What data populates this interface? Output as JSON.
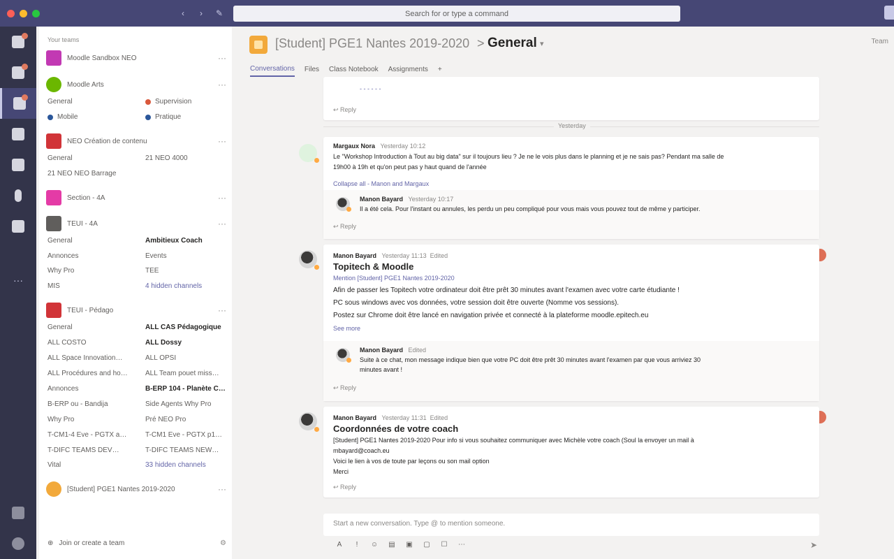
{
  "search": {
    "placeholder": "Search for or type a command"
  },
  "sidebar_header": "Your teams",
  "teams": [
    {
      "name": "Moodle Sandbox NEO",
      "color": "#c239b3"
    },
    {
      "name": "Moodle Arts",
      "color": "#6bb700"
    },
    {
      "name": "NEO Création de contenu",
      "color": "#d13438"
    },
    {
      "name": "Section - 4A",
      "color": "#e43ba6"
    },
    {
      "name": "TEUI - 4A",
      "color": "#605e5c"
    },
    {
      "name": "TEUI - Pédago",
      "color": "#d13438"
    },
    {
      "name": "[Student] PGE1 Nantes 2019-2020",
      "color": "#f2a93b"
    }
  ],
  "team_channels": {
    "arts": [
      "General",
      "Supervision",
      "Mobile",
      "Pratique"
    ],
    "neo": [
      "General",
      "21 NEO 4000",
      "21 NEO NEO Barrage"
    ],
    "teui4a": [
      "General",
      "Ambitieux Coach",
      "Annonces",
      "Events",
      "Why Pro",
      "TEE",
      "MIS",
      "4 hidden channels"
    ],
    "pedago": [
      "General",
      "ALL CAS Pédagogique",
      "ALL COSTO",
      "ALL Dossy",
      "ALL Space Innovation…",
      "ALL OPSI",
      "ALL Procédures and ho…",
      "ALL Team pouet miss…",
      "Annonces",
      "B-ERP 104 - Planète C…",
      "B-ERP ou - Bandija",
      "Side Agents Why Pro",
      "Why Pro",
      "Pré NEO Pro",
      "T-CM1-4 Eve - PGTX a…",
      "T-CM1 Eve - PGTX p1…",
      "T-DIFC TEAMS DEV…",
      "T-DIFC TEAMS NEW…",
      "Vital",
      "33 hidden channels"
    ]
  },
  "join_create": "Join or create a team",
  "channel_header": {
    "team": "[Student] PGE1 Nantes 2019-2020",
    "separator": ">",
    "channel": "General",
    "action": "Team"
  },
  "tabs": [
    "Conversations",
    "Files",
    "Class Notebook",
    "Assignments",
    "+"
  ],
  "day_divider": "Yesterday",
  "posts": {
    "top_reply": "Reply",
    "post1": {
      "author": "Margaux Nora",
      "time": "Yesterday 10:12",
      "body1": "Le \"Workshop Introduction à Tout au big data\" sur il toujours lieu ? Je ne le vois plus dans le planning et je ne sais pas? Pendant ma salle de",
      "body2": "19h00 à 19h et qu'on peut pas y haut quand de l'année",
      "collapse": "Collapse all - Manon and Margaux",
      "reply_author": "Manon Bayard",
      "reply_time": "Yesterday 10:17",
      "reply_text": "Il a été cela. Pour l'instant ou annules, les perdu un peu compliqué pour vous mais vous pouvez tout de même y participer.",
      "reply": "Reply"
    },
    "post2": {
      "author": "Manon Bayard",
      "time": "Yesterday 11:13",
      "edited": "Edited",
      "title": "Topitech & Moodle",
      "tags": "Mention [Student] PGE1 Nantes 2019-2020",
      "body1": "Afin de passer les Topitech votre ordinateur doit être prêt 30 minutes avant l'examen avec votre carte étudiante !",
      "body2": "PC sous windows avec vos données, votre session doit être ouverte (Nomme vos sessions).",
      "body3": "Postez sur Chrome doit être lancé en navigation privée et connecté à la plateforme moodle.epitech.eu",
      "see_more": "See more",
      "reply_author": "Manon Bayard",
      "reply_time": "Edited",
      "reply_text1": "Suite à ce chat, mon message indique bien que votre PC doit être prêt 30 minutes avant l'examen par que vous arriviez 30",
      "reply_text2": "minutes avant !",
      "reply": "Reply"
    },
    "post3": {
      "author": "Manon Bayard",
      "time": "Yesterday 11:31",
      "edited": "Edited",
      "title": "Coordonnées de votre coach",
      "body1": "[Student] PGE1 Nantes 2019-2020 Pour info si vous souhaitez communiquer avec Michèle votre coach (Soul la envoyer un mail à",
      "body2": "mbayard@coach.eu",
      "body3": "Voici le lien à vos de toute par leçons ou son mail option",
      "body4": "Merci",
      "reply": "Reply"
    }
  },
  "composer": {
    "placeholder": "Start a new conversation. Type @ to mention someone."
  },
  "toolbar": [
    "A",
    "!",
    "☺",
    "▤",
    "▣",
    "▢",
    "☐",
    "⋯"
  ],
  "send": "➤",
  "colors": {
    "rail": "#33344a",
    "titlebar": "#464775",
    "accent": "#6264a7"
  }
}
